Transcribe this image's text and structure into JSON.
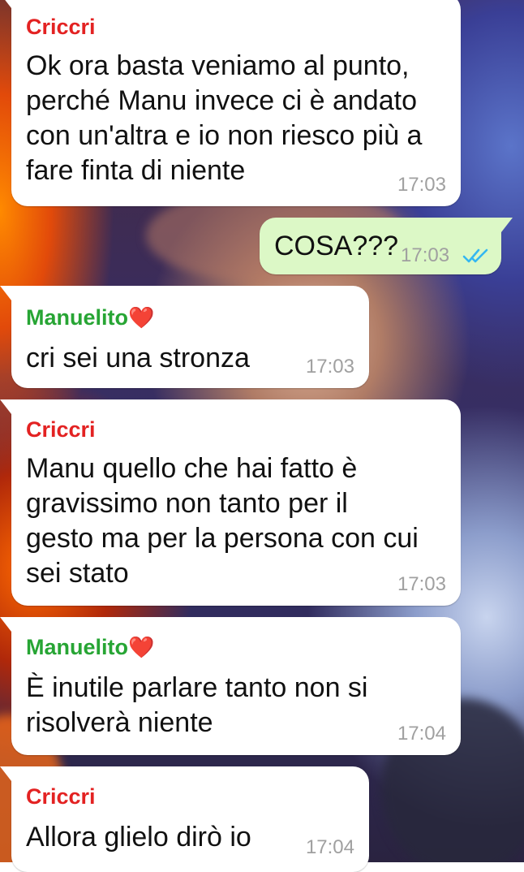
{
  "messages": [
    {
      "sender": "Criccri",
      "lines": [
        "Ok ora basta veniamo al punto,",
        "perché Manu invece ci è andato",
        "con un'altra e io non riesco più a",
        "fare finta di niente"
      ],
      "time": "17:03"
    },
    {
      "outgoing": true,
      "text": "COSA???",
      "time": "17:03",
      "status": "read"
    },
    {
      "sender": "Manuelito",
      "sender_emoji": "❤️",
      "lines": [
        "cri sei una stronza"
      ],
      "time": "17:03"
    },
    {
      "sender": "Criccri",
      "lines": [
        "Manu quello che hai fatto è",
        "gravissimo non tanto per il",
        "gesto ma per la persona con cui",
        "sei stato"
      ],
      "time": "17:03"
    },
    {
      "sender": "Manuelito",
      "sender_emoji": "❤️",
      "lines": [
        "È inutile parlare tanto non si",
        "risolverà niente"
      ],
      "time": "17:04"
    },
    {
      "sender": "Criccri",
      "lines": [
        "Allora glielo dirò io"
      ],
      "time": "17:04"
    }
  ],
  "colors": {
    "criccri_name": "#e32222",
    "manuelito_name": "#27a534",
    "outgoing_bubble": "#dcf8c6",
    "incoming_bubble": "#ffffff",
    "read_ticks": "#34b7f1",
    "timestamp": "#a0a0a0"
  }
}
